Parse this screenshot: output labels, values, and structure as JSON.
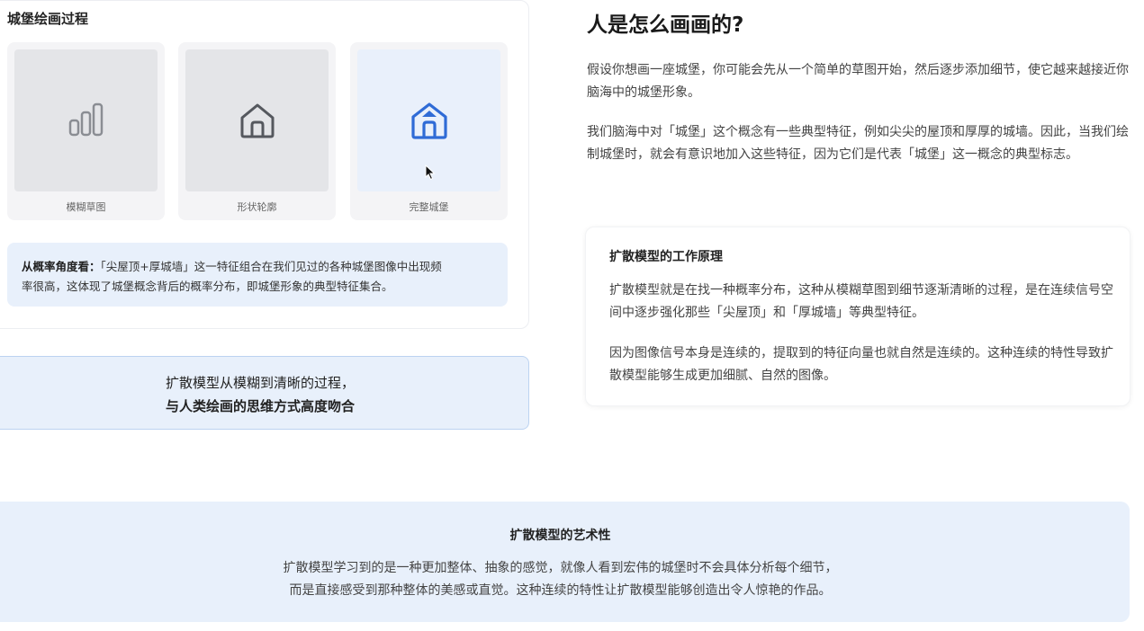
{
  "process": {
    "title": "城堡绘画过程",
    "steps": [
      {
        "label": "模糊草图",
        "icon": "bar-chart-icon"
      },
      {
        "label": "形状轮廓",
        "icon": "house-outline-icon"
      },
      {
        "label": "完整城堡",
        "icon": "castle-icon"
      }
    ],
    "note_prefix": "从概率角度看：",
    "note_line1": "「尖屋顶+厚城墙」这一特征组合在我们见过的各种城堡图像中出现频",
    "note_line2": "率很高，这体现了城堡概念背后的概率分布，即城堡形象的典型特征集合。"
  },
  "summary": {
    "line1": "扩散模型从模糊到清晰的过程，",
    "line2": "与人类绘画的思维方式高度吻合"
  },
  "right": {
    "heading": "人是怎么画画的?",
    "para1": "假设你想画一座城堡，你可能会先从一个简单的草图开始，然后逐步添加细节，使它越来越接近你脑海中的城堡形象。",
    "para2": "我们脑海中对「城堡」这个概念有一些典型特征，例如尖尖的屋顶和厚厚的城墙。因此，当我们绘制城堡时，就会有意识地加入这些特征，因为它们是代表「城堡」这一概念的典型标志。",
    "card": {
      "title": "扩散模型的工作原理",
      "p1": "扩散模型就是在找一种概率分布，这种从模糊草图到细节逐渐清晰的过程，是在连续信号空间中逐步强化那些「尖屋顶」和「厚城墙」等典型特征。",
      "p2": "因为图像信号本身是连续的，提取到的特征向量也就自然是连续的。这种连续的特性导致扩散模型能够生成更加细腻、自然的图像。"
    }
  },
  "art": {
    "title": "扩散模型的艺术性",
    "line1": "扩散模型学习到的是一种更加整体、抽象的感觉，就像人看到宏伟的城堡时不会具体分析每个细节，",
    "line2": "而是直接感受到那种整体的美感或直觉。这种连续的特性让扩散模型能够创造出令人惊艳的作品。"
  },
  "colors": {
    "accent": "#2f6bd6",
    "panel_bg": "#e8f0fb",
    "icon_gray": "#8a8d93"
  }
}
